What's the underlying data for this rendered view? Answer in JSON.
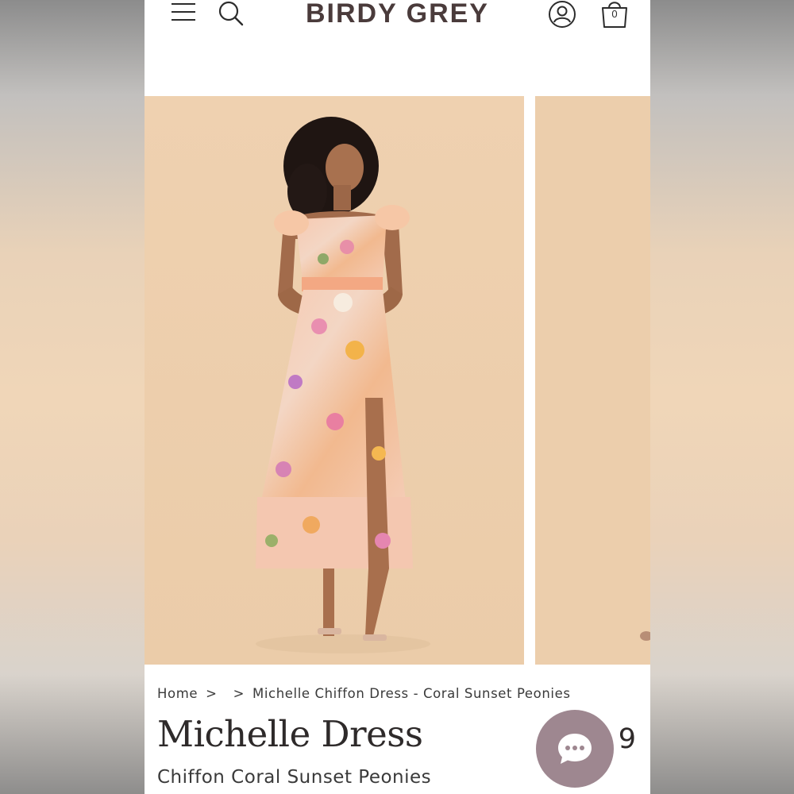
{
  "header": {
    "logo": "BIRDY GREY",
    "bag_count": "0",
    "icons": [
      "hamburger-menu-icon",
      "search-icon",
      "account-icon",
      "shopping-bag-icon"
    ]
  },
  "gallery": {
    "images": [
      "model-front-floral-dress",
      "model-next-image-partial"
    ]
  },
  "breadcrumb": {
    "home": "Home",
    "separator": ">",
    "current": "Michelle Chiffon Dress - Coral Sunset Peonies"
  },
  "product": {
    "title": "Michelle Dress",
    "subtitle": "Chiffon Coral Sunset Peonies",
    "price_visible": "9"
  },
  "chat": {
    "icon": "chat-bubble-icon",
    "color": "#9e8790"
  },
  "colors": {
    "logo": "#4a3b3b",
    "photo_background": "#edcfae"
  }
}
